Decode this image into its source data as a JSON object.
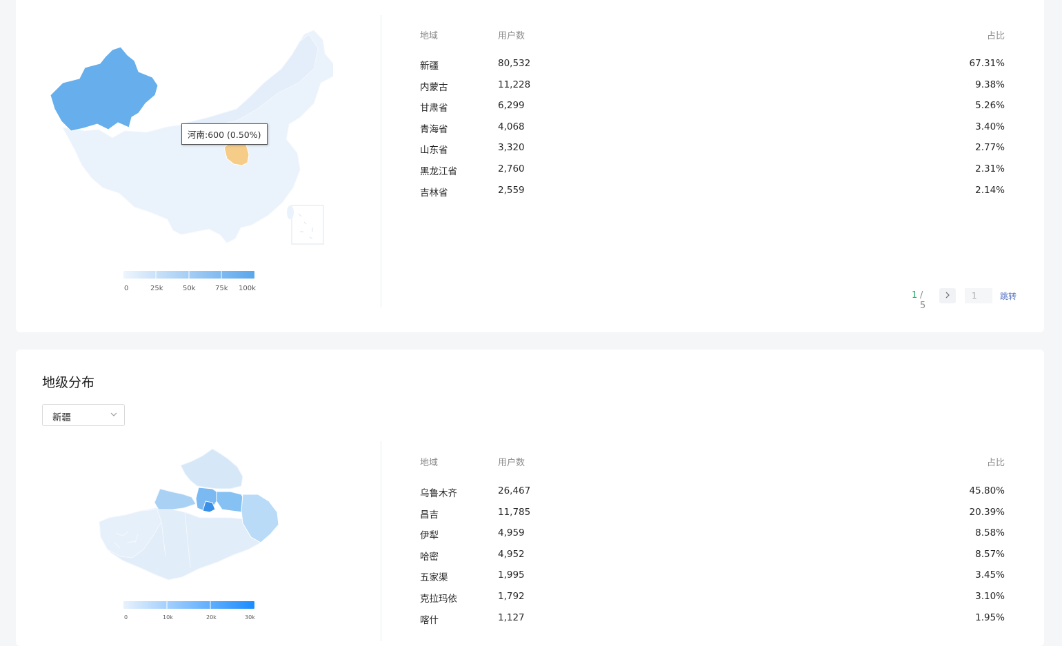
{
  "colors": {
    "map_low": "#e8f1fb",
    "map_high": "#5aa6ec",
    "highlight": "#f6cd8b",
    "sub_map_high": "#1a8cff",
    "pager_current": "#2db06b"
  },
  "province_map": {
    "tooltip": "河南:600 (0.50%)",
    "legend_ticks": [
      "0",
      "25k",
      "50k",
      "75k",
      "100k"
    ]
  },
  "province_table": {
    "headers": {
      "region": "地域",
      "users": "用户数",
      "ratio": "占比"
    },
    "rows": [
      {
        "region": "新疆",
        "users": "80,532",
        "ratio": "67.31%"
      },
      {
        "region": "内蒙古",
        "users": "11,228",
        "ratio": "9.38%"
      },
      {
        "region": "甘肃省",
        "users": "6,299",
        "ratio": "5.26%"
      },
      {
        "region": "青海省",
        "users": "4,068",
        "ratio": "3.40%"
      },
      {
        "region": "山东省",
        "users": "3,320",
        "ratio": "2.77%"
      },
      {
        "region": "黑龙江省",
        "users": "2,760",
        "ratio": "2.31%"
      },
      {
        "region": "吉林省",
        "users": "2,559",
        "ratio": "2.14%"
      }
    ]
  },
  "pagination": {
    "current": "1",
    "total": "/ 5",
    "next_icon": "chevron-right-icon",
    "jump_value": "1",
    "jump_label": "跳转"
  },
  "city_section": {
    "title": "地级分布",
    "select_value": "新疆",
    "legend_ticks": [
      "0",
      "10k",
      "20k",
      "30k"
    ],
    "table": {
      "headers": {
        "region": "地域",
        "users": "用户数",
        "ratio": "占比"
      },
      "rows": [
        {
          "region": "乌鲁木齐",
          "users": "26,467",
          "ratio": "45.80%"
        },
        {
          "region": "昌吉",
          "users": "11,785",
          "ratio": "20.39%"
        },
        {
          "region": "伊犁",
          "users": "4,959",
          "ratio": "8.58%"
        },
        {
          "region": "哈密",
          "users": "4,952",
          "ratio": "8.57%"
        },
        {
          "region": "五家渠",
          "users": "1,995",
          "ratio": "3.45%"
        },
        {
          "region": "克拉玛依",
          "users": "1,792",
          "ratio": "3.10%"
        },
        {
          "region": "喀什",
          "users": "1,127",
          "ratio": "1.95%"
        }
      ]
    }
  }
}
